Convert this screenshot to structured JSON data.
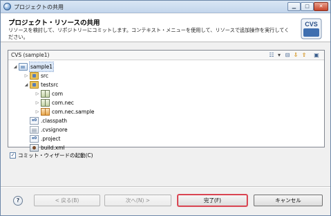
{
  "window": {
    "title": "プロジェクトの共用",
    "controls": {
      "minimize": "▁",
      "maximize": "□",
      "close": "✕"
    }
  },
  "banner": {
    "title": "プロジェクト・リソースの共用",
    "description": "リソースを検討して、リポジトリーにコミットします。コンテキスト・メニューを使用して、リソースで追加操作を実行してください。",
    "icon": "cvs-repository-icon",
    "icon_text": "CVS"
  },
  "panel": {
    "title": "CVS (sample1)",
    "toolbar": [
      {
        "name": "tree-mode-icon",
        "glyph": "☷"
      },
      {
        "name": "view-menu-dropdown-icon",
        "glyph": "▾"
      },
      {
        "name": "collapse-all-icon",
        "glyph": "⊟"
      },
      {
        "name": "next-change-icon",
        "glyph": "⇩"
      },
      {
        "name": "previous-change-icon",
        "glyph": "⇧"
      },
      {
        "name": "pin-icon",
        "glyph": "▣"
      }
    ]
  },
  "tree": [
    {
      "label": "sample1",
      "level": 0,
      "twisty": "◢",
      "icon": "project-icon",
      "selected": true
    },
    {
      "label": "src",
      "level": 1,
      "twisty": "▷",
      "icon": "source-folder-icon"
    },
    {
      "label": "testsrc",
      "level": 1,
      "twisty": "◢",
      "icon": "source-folder-icon"
    },
    {
      "label": "com",
      "level": 2,
      "twisty": "▷",
      "icon": "package-icon"
    },
    {
      "label": "com.nec",
      "level": 2,
      "twisty": "▷",
      "icon": "package-icon"
    },
    {
      "label": "com.nec.sample",
      "level": 2,
      "twisty": "▷",
      "icon": "package-orange-icon"
    },
    {
      "label": ".classpath",
      "level": 1,
      "twisty": "",
      "icon": "xml-file-icon",
      "icon_text": "x0"
    },
    {
      "label": ".cvsignore",
      "level": 1,
      "twisty": "",
      "icon": "text-file-icon"
    },
    {
      "label": ".project",
      "level": 1,
      "twisty": "",
      "icon": "xml-file-icon",
      "icon_text": "x0"
    },
    {
      "label": "build.xml",
      "level": 1,
      "twisty": "",
      "icon": "ant-file-icon"
    }
  ],
  "checkbox": {
    "label": "コミット・ウィザードの起動(C)",
    "checked": true,
    "mark": "✓"
  },
  "buttons": {
    "help": "?",
    "back": "< 戻る(B)",
    "next": "次へ(N) >",
    "finish": "完了(F)",
    "cancel": "キャンセル"
  }
}
